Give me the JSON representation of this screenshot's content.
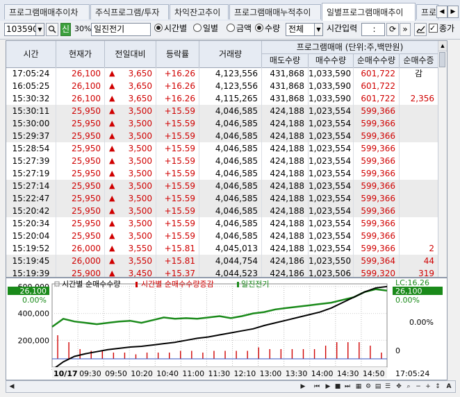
{
  "tabs": [
    {
      "label": "프로그램매매추이차"
    },
    {
      "label": "주식프로그램/투자"
    },
    {
      "label": "차익잔고추이"
    },
    {
      "label": "프로그램매매누적추이"
    },
    {
      "label": "일별프로그램매매추이"
    },
    {
      "label": "프로"
    }
  ],
  "toolbar": {
    "code": "103590",
    "credit_badge": "신",
    "margin": "30%",
    "stock_name": "일진전기",
    "radio_time": "시간별",
    "radio_day": "일별",
    "radio_amount": "금액",
    "radio_qty": "수량",
    "select_all": "전체",
    "time_input_label": "시간입력",
    "time_value": " : ",
    "close_price_label": "종가"
  },
  "table": {
    "headers": {
      "time": "시간",
      "price": "현재가",
      "change": "전일대비",
      "rate": "등락률",
      "volume": "거래량",
      "program_group": "프로그램매매 (단위:주,백만원)",
      "sell": "매도수량",
      "buy": "매수수량",
      "net": "순매수수량",
      "net_change": "순매수증감"
    },
    "rows": [
      {
        "time": "17:05:24",
        "price": "26,100",
        "change": "3,650",
        "rate": "+16.26",
        "volume": "4,123,556",
        "sell": "431,868",
        "buy": "1,033,590",
        "net": "601,722",
        "net_change": ""
      },
      {
        "time": "16:05:25",
        "price": "26,100",
        "change": "3,650",
        "rate": "+16.26",
        "volume": "4,123,556",
        "sell": "431,868",
        "buy": "1,033,590",
        "net": "601,722",
        "net_change": ""
      },
      {
        "time": "15:30:32",
        "price": "26,100",
        "change": "3,650",
        "rate": "+16.26",
        "volume": "4,115,265",
        "sell": "431,868",
        "buy": "1,033,590",
        "net": "601,722",
        "net_change": "2,356"
      },
      {
        "time": "15:30:11",
        "price": "25,950",
        "change": "3,500",
        "rate": "+15.59",
        "volume": "4,046,585",
        "sell": "424,188",
        "buy": "1,023,554",
        "net": "599,366",
        "net_change": ""
      },
      {
        "time": "15:30:00",
        "price": "25,950",
        "change": "3,500",
        "rate": "+15.59",
        "volume": "4,046,585",
        "sell": "424,188",
        "buy": "1,023,554",
        "net": "599,366",
        "net_change": ""
      },
      {
        "time": "15:29:37",
        "price": "25,950",
        "change": "3,500",
        "rate": "+15.59",
        "volume": "4,046,585",
        "sell": "424,188",
        "buy": "1,023,554",
        "net": "599,366",
        "net_change": ""
      },
      {
        "time": "15:28:54",
        "price": "25,950",
        "change": "3,500",
        "rate": "+15.59",
        "volume": "4,046,585",
        "sell": "424,188",
        "buy": "1,023,554",
        "net": "599,366",
        "net_change": ""
      },
      {
        "time": "15:27:39",
        "price": "25,950",
        "change": "3,500",
        "rate": "+15.59",
        "volume": "4,046,585",
        "sell": "424,188",
        "buy": "1,023,554",
        "net": "599,366",
        "net_change": ""
      },
      {
        "time": "15:27:19",
        "price": "25,950",
        "change": "3,500",
        "rate": "+15.59",
        "volume": "4,046,585",
        "sell": "424,188",
        "buy": "1,023,554",
        "net": "599,366",
        "net_change": ""
      },
      {
        "time": "15:27:14",
        "price": "25,950",
        "change": "3,500",
        "rate": "+15.59",
        "volume": "4,046,585",
        "sell": "424,188",
        "buy": "1,023,554",
        "net": "599,366",
        "net_change": ""
      },
      {
        "time": "15:22:47",
        "price": "25,950",
        "change": "3,500",
        "rate": "+15.59",
        "volume": "4,046,585",
        "sell": "424,188",
        "buy": "1,023,554",
        "net": "599,366",
        "net_change": ""
      },
      {
        "time": "15:20:42",
        "price": "25,950",
        "change": "3,500",
        "rate": "+15.59",
        "volume": "4,046,585",
        "sell": "424,188",
        "buy": "1,023,554",
        "net": "599,366",
        "net_change": ""
      },
      {
        "time": "15:20:34",
        "price": "25,950",
        "change": "3,500",
        "rate": "+15.59",
        "volume": "4,046,585",
        "sell": "424,188",
        "buy": "1,023,554",
        "net": "599,366",
        "net_change": ""
      },
      {
        "time": "15:20:04",
        "price": "25,950",
        "change": "3,500",
        "rate": "+15.59",
        "volume": "4,046,585",
        "sell": "424,188",
        "buy": "1,023,554",
        "net": "599,366",
        "net_change": ""
      },
      {
        "time": "15:19:52",
        "price": "26,000",
        "change": "3,550",
        "rate": "+15.81",
        "volume": "4,045,013",
        "sell": "424,188",
        "buy": "1,023,554",
        "net": "599,366",
        "net_change": "2"
      },
      {
        "time": "15:19:45",
        "price": "26,000",
        "change": "3,550",
        "rate": "+15.81",
        "volume": "4,044,754",
        "sell": "424,186",
        "buy": "1,023,550",
        "net": "599,364",
        "net_change": "44"
      },
      {
        "time": "15:19:39",
        "price": "25,900",
        "change": "3,450",
        "rate": "+15.37",
        "volume": "4,044,523",
        "sell": "424,186",
        "buy": "1,023,506",
        "net": "599,320",
        "net_change": "319"
      }
    ]
  },
  "chart_data": {
    "type": "line",
    "legend": {
      "item1": "시간별 순매수수량",
      "item2": "시간별 순매수수량증감",
      "item3": "일진전기"
    },
    "left_axis": {
      "ticks": [
        "600,000",
        "400,000",
        "200,000"
      ],
      "ylim": [
        0,
        620000
      ]
    },
    "right_axis": {
      "ticks": [
        "LC:16.26",
        "26,100",
        "0.00%",
        "0"
      ]
    },
    "left_badge": {
      "value": "26,100",
      "pct": "0.00%"
    },
    "x_ticks": [
      "10/17",
      "09:30",
      "09:50",
      "10:20",
      "10:40",
      "11:00",
      "11:30",
      "12:10",
      "13:00",
      "13:30",
      "14:00",
      "14:30",
      "14:50",
      "17:05:24"
    ],
    "net_buy_series": [
      -20000,
      40000,
      80000,
      100000,
      115000,
      130000,
      140000,
      150000,
      155000,
      165000,
      175000,
      185000,
      200000,
      215000,
      225000,
      240000,
      255000,
      270000,
      285000,
      310000,
      330000,
      350000,
      370000,
      390000,
      410000,
      440000,
      480000,
      520000,
      560000,
      590000,
      600000
    ],
    "price_series": [
      300000,
      360000,
      340000,
      330000,
      320000,
      330000,
      340000,
      345000,
      330000,
      350000,
      370000,
      360000,
      365000,
      360000,
      370000,
      380000,
      365000,
      380000,
      400000,
      410000,
      430000,
      440000,
      450000,
      460000,
      470000,
      480000,
      500000,
      520000,
      560000,
      580000,
      570000
    ],
    "colors": {
      "net_buy": "#000000",
      "price": "#1a8a1a",
      "bars": "#d00000"
    }
  }
}
